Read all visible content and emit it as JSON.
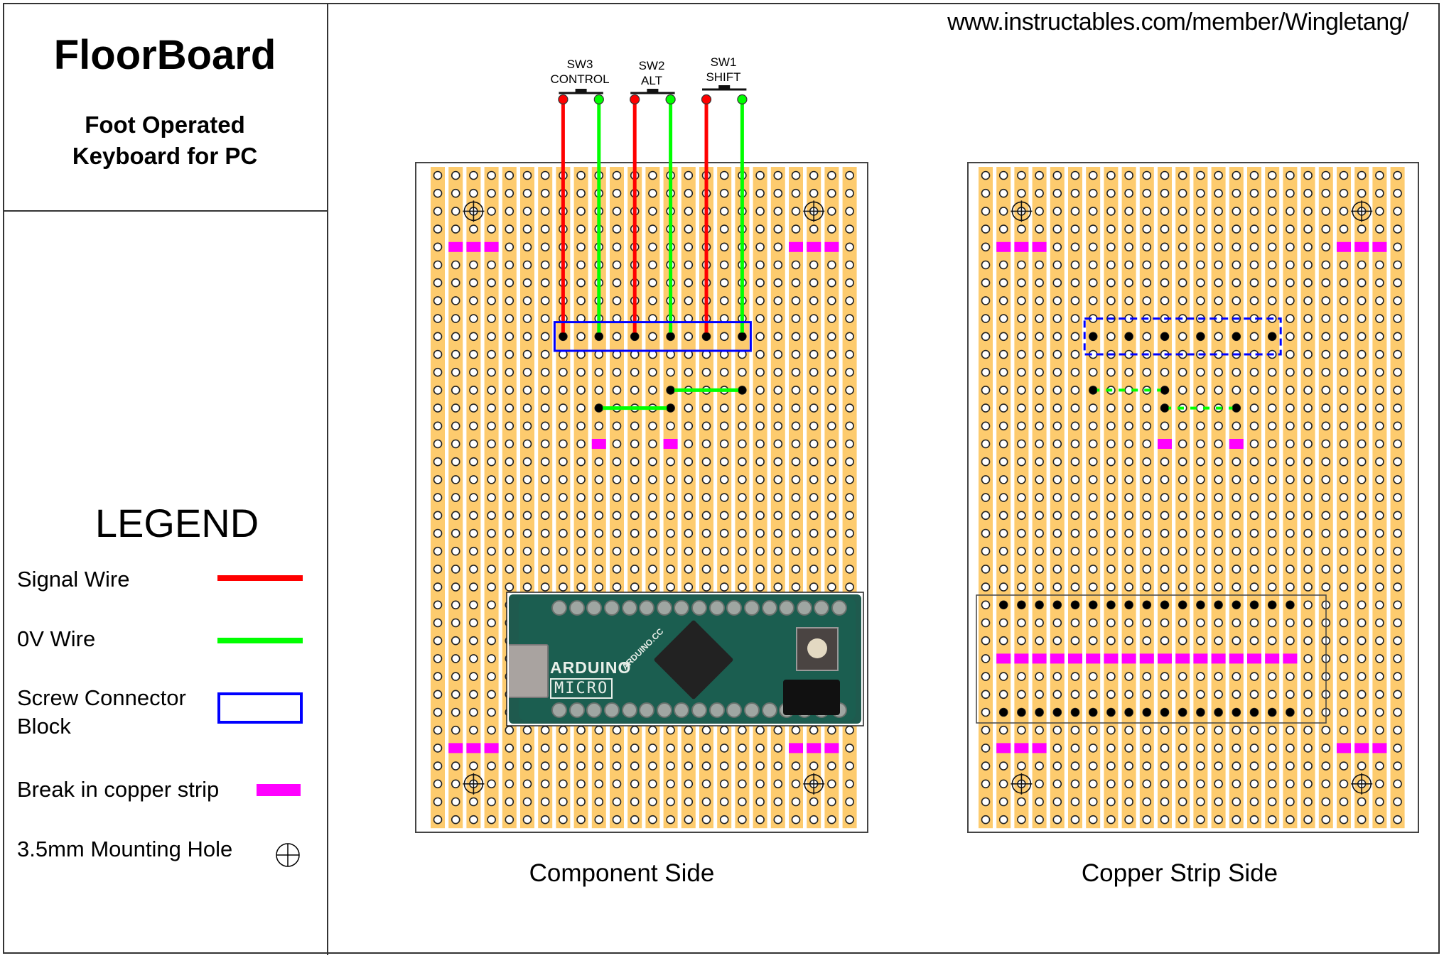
{
  "header": {
    "title": "FloorBoard",
    "subtitle_line1": "Foot Operated",
    "subtitle_line2": "Keyboard for PC",
    "url": "www.instructables.com/member/Wingletang/"
  },
  "legend": {
    "title": "LEGEND",
    "items": [
      {
        "label": "Signal Wire",
        "symbol": "red-line"
      },
      {
        "label": "0V Wire",
        "symbol": "green-line"
      },
      {
        "label_line1": "Screw Connector",
        "label_line2": "Block",
        "symbol": "blue-rectangle"
      },
      {
        "label": "Break in copper strip",
        "symbol": "magenta-block"
      },
      {
        "label": "3.5mm Mounting Hole",
        "symbol": "crosshair-circle"
      }
    ]
  },
  "colors": {
    "signal_wire": "#ff0000",
    "zero_v_wire": "#00ff00",
    "screw_connector": "#0000ff",
    "strip_break": "#ff00ff",
    "copper_strip": "#fdcb6e",
    "hole": "#ffffff",
    "solder_point": "#000000"
  },
  "switches": [
    {
      "id": "SW3",
      "function": "CONTROL",
      "signal_col": 8,
      "ground_col": 10
    },
    {
      "id": "SW2",
      "function": "ALT",
      "signal_col": 12,
      "ground_col": 14
    },
    {
      "id": "SW1",
      "function": "SHIFT",
      "signal_col": 16,
      "ground_col": 18
    }
  ],
  "stripboard": {
    "columns": 24,
    "rows": 37,
    "mounting_holes": [
      {
        "col": 3,
        "row": 3
      },
      {
        "col": 22,
        "row": 3
      },
      {
        "col": 3,
        "row": 35
      },
      {
        "col": 22,
        "row": 35
      }
    ],
    "corner_breaks": [
      {
        "cols": [
          2,
          3,
          4
        ],
        "row": 5
      },
      {
        "cols": [
          21,
          22,
          23
        ],
        "row": 5
      },
      {
        "cols": [
          2,
          3,
          4
        ],
        "row": 33
      },
      {
        "cols": [
          21,
          22,
          23
        ],
        "row": 33
      }
    ]
  },
  "component_side": {
    "label": "Component Side",
    "screw_connector": {
      "cols": [
        8,
        18
      ],
      "rows": [
        9,
        11
      ],
      "pin_row": 10,
      "pin_cols": [
        8,
        10,
        12,
        14,
        16,
        18
      ]
    },
    "ground_links": [
      {
        "from_col": 14,
        "to_col": 18,
        "row": 13
      },
      {
        "from_col": 10,
        "to_col": 14,
        "row": 14
      }
    ],
    "breaks": [
      {
        "col": 10,
        "row": 16
      },
      {
        "col": 14,
        "row": 16
      }
    ],
    "arduino": {
      "name": "ARDUINO",
      "model": "MICRO",
      "site": "ARDUINO.CC",
      "cols": [
        6,
        24
      ],
      "rows": [
        24,
        30
      ]
    }
  },
  "copper_side": {
    "label": "Copper Strip Side",
    "screw_connector": {
      "cols": [
        7,
        17
      ],
      "rows": [
        9,
        11
      ],
      "pin_row": 10,
      "pin_cols": [
        7,
        9,
        11,
        13,
        15,
        17
      ]
    },
    "ground_links": [
      {
        "from_col": 7,
        "to_col": 11,
        "row": 13
      },
      {
        "from_col": 11,
        "to_col": 15,
        "row": 14
      }
    ],
    "breaks": [
      {
        "col": 11,
        "row": 16
      },
      {
        "col": 15,
        "row": 16
      }
    ],
    "arduino_footprint": {
      "cols": [
        2,
        18
      ],
      "pin_rows": [
        25,
        31
      ],
      "break_row": 28
    }
  }
}
